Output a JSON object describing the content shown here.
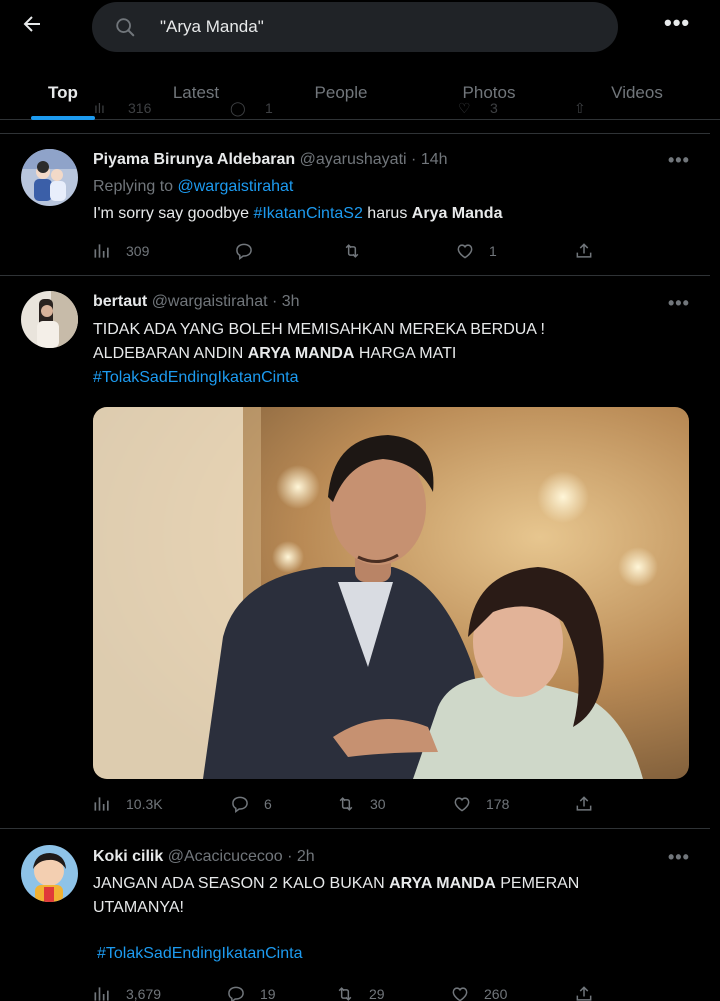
{
  "search": {
    "query": "\"Arya Manda\""
  },
  "tabs": [
    {
      "label": "Top",
      "active": true
    },
    {
      "label": "Latest"
    },
    {
      "label": "People"
    },
    {
      "label": "Photos"
    },
    {
      "label": "Videos"
    }
  ],
  "ghost_counts": {
    "views": "316",
    "replies": "1",
    "likes": "3"
  },
  "tweets": [
    {
      "name": "Piyama Birunya Aldebaran",
      "handle": "@ayarushayati",
      "sep": "·",
      "time": "14h",
      "reply_prefix": "Replying to",
      "reply_to": "@wargaistirahat",
      "text_a": "I'm sorry say goodbye ",
      "hashtag": "#IkatanCintaS2",
      "text_b": " harus ",
      "bold": "Arya Manda",
      "views": "309",
      "replies": "",
      "retweets": "",
      "likes": "1"
    },
    {
      "name": "bertaut",
      "handle": "@wargaistirahat",
      "sep": "·",
      "time": "3h",
      "line1": "TIDAK ADA YANG BOLEH MEMISAHKAN MEREKA BERDUA !",
      "line2_a": "ALDEBARAN ANDIN ",
      "line2_bold": "ARYA MANDA",
      "line2_b": " HARGA MATI",
      "hashtag": "#TolakSadEndingIkatanCinta",
      "views": "10.3K",
      "replies": "6",
      "retweets": "30",
      "likes": "178"
    },
    {
      "name": "Koki cilik",
      "handle": "@Acacicucecoo",
      "sep": "·",
      "time": "2h",
      "line1_a": "JANGAN ADA SEASON 2 KALO BUKAN ",
      "line1_bold": "ARYA MANDA",
      "line1_b": " PEMERAN",
      "line2": "UTAMANYA!",
      "hashtag": "#TolakSadEndingIkatanCinta",
      "views": "3,679",
      "replies": "19",
      "retweets": "29",
      "likes": "260"
    }
  ],
  "colors": {
    "accent": "#1d9bf0",
    "muted": "#71767b",
    "text": "#e7e9ea",
    "border": "#2f3336",
    "bg": "#000000"
  }
}
